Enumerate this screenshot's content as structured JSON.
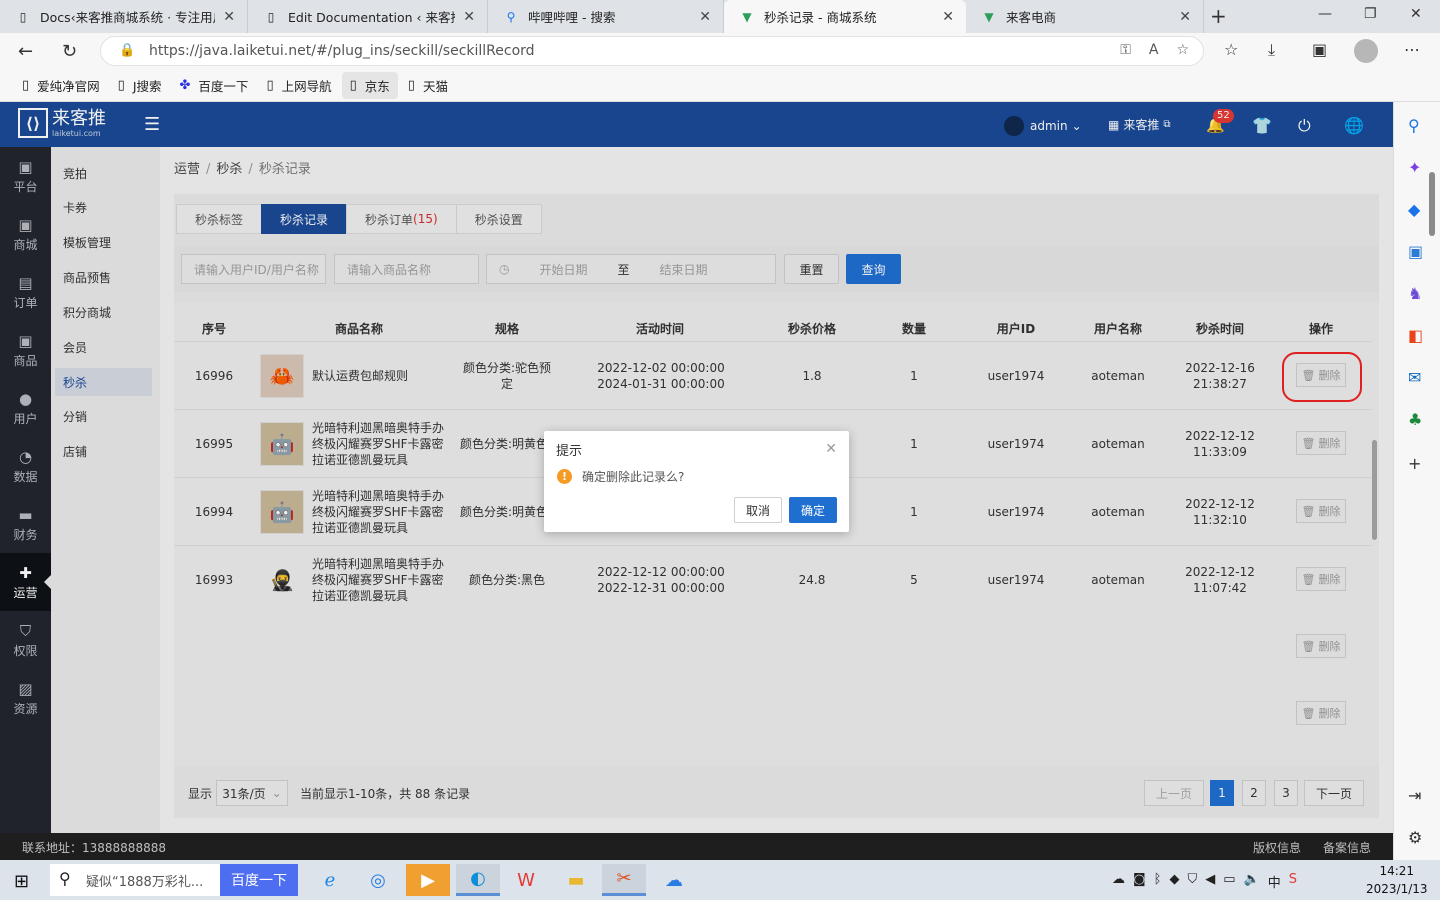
{
  "browser": {
    "tabs": [
      {
        "title": "Docs‹来客推商城系统 · 专注用户",
        "icon": "doc-icon"
      },
      {
        "title": "Edit Documentation ‹ 来客推商城",
        "icon": "doc-icon"
      },
      {
        "title": "哔哩哔哩 - 搜索",
        "icon": "search-icon"
      },
      {
        "title": "秒杀记录 - 商城系统",
        "icon": "vue-icon"
      },
      {
        "title": "来客电商",
        "icon": "vue-icon"
      }
    ],
    "url": "https://java.laiketui.net/#/plug_ins/seckill/seckillRecord",
    "bookmarks": [
      "爱纯净官网",
      "J搜索",
      "百度一下",
      "上网导航",
      "京东",
      "天猫"
    ]
  },
  "topnav": {
    "logo_main": "来客推",
    "logo_sub": "laiketui.com",
    "user": "admin",
    "shop": "来客推",
    "notif_count": "52"
  },
  "leftnav": [
    {
      "label": "平台",
      "icon": "platform-icon"
    },
    {
      "label": "商城",
      "icon": "mall-icon"
    },
    {
      "label": "订单",
      "icon": "order-icon"
    },
    {
      "label": "商品",
      "icon": "goods-icon"
    },
    {
      "label": "用户",
      "icon": "user-icon"
    },
    {
      "label": "数据",
      "icon": "chart-icon"
    },
    {
      "label": "财务",
      "icon": "finance-icon"
    },
    {
      "label": "运营",
      "icon": "puzzle-icon"
    },
    {
      "label": "权限",
      "icon": "shield-icon"
    },
    {
      "label": "资源",
      "icon": "image-icon"
    }
  ],
  "subnav": [
    "竞拍",
    "卡券",
    "模板管理",
    "商品预售",
    "积分商城",
    "会员",
    "秒杀",
    "分销",
    "店铺"
  ],
  "breadcrumb": [
    "运营",
    "秒杀",
    "秒杀记录"
  ],
  "tabs": {
    "t1": "秒杀标签",
    "t2": "秒杀记录",
    "t3": "秒杀订单",
    "t3_count": "(15)",
    "t4": "秒杀设置"
  },
  "filter": {
    "user_ph": "请输入用户ID/用户名称",
    "goods_ph": "请输入商品名称",
    "start_ph": "开始日期",
    "to": "至",
    "end_ph": "结束日期",
    "reset": "重置",
    "query": "查询"
  },
  "table": {
    "headers": [
      "序号",
      "商品名称",
      "规格",
      "活动时间",
      "秒杀价格",
      "数量",
      "用户ID",
      "用户名称",
      "秒杀时间",
      "操作"
    ],
    "delete_label": "删除",
    "rows": [
      {
        "id": "16996",
        "name": "默认运费包邮规则",
        "spec": "颜色分类:驼色预定",
        "time1": "2022-12-02 00:00:00",
        "time2": "2024-01-31 00:00:00",
        "price": "1.8",
        "qty": "1",
        "uid": "user1974",
        "uname": "aoteman",
        "stime": "2022-12-16 21:38:27"
      },
      {
        "id": "16995",
        "name": "光暗特利迦黑暗奥特手办终极闪耀赛罗SHF卡露密拉诺亚德凯曼玩具",
        "spec": "颜色分类:明黄色",
        "time1": "",
        "time2": "",
        "price": "",
        "qty": "1",
        "uid": "user1974",
        "uname": "aoteman",
        "stime": "2022-12-12 11:33:09"
      },
      {
        "id": "16994",
        "name": "光暗特利迦黑暗奥特手办终极闪耀赛罗SHF卡露密拉诺亚德凯曼玩具",
        "spec": "颜色分类:明黄色",
        "time1": "",
        "time2": "",
        "price": "",
        "qty": "1",
        "uid": "user1974",
        "uname": "aoteman",
        "stime": "2022-12-12 11:32:10"
      },
      {
        "id": "16993",
        "name": "光暗特利迦黑暗奥特手办终极闪耀赛罗SHF卡露密拉诺亚德凯曼玩具",
        "spec": "颜色分类:黑色",
        "time1": "2022-12-12 00:00:00",
        "time2": "2022-12-31 00:00:00",
        "price": "24.8",
        "qty": "5",
        "uid": "user1974",
        "uname": "aoteman",
        "stime": "2022-12-12 11:07:42"
      }
    ]
  },
  "pagination": {
    "show_label": "显示",
    "page_size": "31条/页",
    "summary": "当前显示1-10条，共 88 条记录",
    "prev": "上一页",
    "pages": [
      "1",
      "2",
      "3"
    ],
    "next": "下一页"
  },
  "footer": {
    "contact": "联系地址：13888888888",
    "copyright": "版权信息",
    "record": "备案信息"
  },
  "dialog": {
    "title": "提示",
    "message": "确定删除此记录么?",
    "cancel": "取消",
    "confirm": "确定"
  },
  "taskbar": {
    "search_text": "疑似“1888万彩礼...",
    "search_btn": "百度一下",
    "ime": "中",
    "time": "14:21",
    "date": "2023/1/13"
  },
  "colors": {
    "primary": "#1a4a96",
    "accent": "#1f6fd1",
    "warn": "#f59a23",
    "danger": "#e02020"
  }
}
